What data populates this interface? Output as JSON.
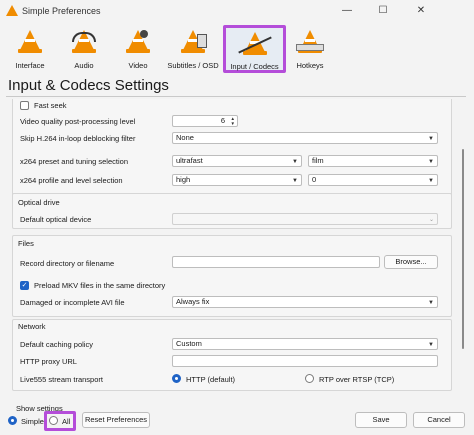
{
  "window": {
    "title": "Simple Preferences",
    "minimize": "—",
    "maximize": "☐",
    "close": "✕"
  },
  "toolbar": {
    "items": [
      {
        "label": "Interface",
        "icon": "vlc-cone-icon"
      },
      {
        "label": "Audio",
        "icon": "headphones-cone-icon"
      },
      {
        "label": "Video",
        "icon": "video-cone-icon"
      },
      {
        "label": "Subtitles / OSD",
        "icon": "subtitles-cone-icon"
      },
      {
        "label": "Input / Codecs",
        "icon": "input-codecs-cone-icon",
        "selected": true
      },
      {
        "label": "Hotkeys",
        "icon": "hotkeys-cone-icon"
      }
    ],
    "accent": "#f08c00",
    "highlight": "#b44dd9"
  },
  "page_title": "Input & Codecs Settings",
  "codecs": {
    "fast_seek_label": "Fast seek",
    "fast_seek_checked": false,
    "vq_label": "Video quality post-processing level",
    "vq_value": "6",
    "skip_label": "Skip H.264 in-loop deblocking filter",
    "skip_value": "None",
    "x264_preset_label": "x264 preset and tuning selection",
    "x264_preset_value": "ultrafast",
    "x264_tuning_value": "film",
    "x264_profile_label": "x264 profile and level selection",
    "x264_profile_value": "high",
    "x264_level_value": "0"
  },
  "optical": {
    "title": "Optical drive",
    "device_label": "Default optical device",
    "device_value": ""
  },
  "files": {
    "title": "Files",
    "record_label": "Record directory or filename",
    "record_value": "",
    "browse_label": "Browse...",
    "preload_label": "Preload MKV files in the same directory",
    "preload_checked": true,
    "damaged_label": "Damaged or incomplete AVI file",
    "damaged_value": "Always fix"
  },
  "network": {
    "title": "Network",
    "caching_label": "Default caching policy",
    "caching_value": "Custom",
    "proxy_label": "HTTP proxy URL",
    "proxy_value": "",
    "live555_label": "Live555 stream transport",
    "option_http": "HTTP (default)",
    "option_rtp": "RTP over RTSP (TCP)",
    "selected": "HTTP (default)"
  },
  "bottom": {
    "show_settings_label": "Show settings",
    "simple_label": "Simple",
    "all_label": "All",
    "selected": "Simple",
    "reset_label": "Reset Preferences",
    "save_label": "Save",
    "cancel_label": "Cancel"
  }
}
